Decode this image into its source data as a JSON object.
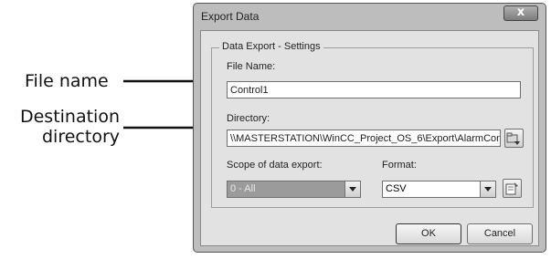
{
  "callouts": {
    "file_name": "File name",
    "destination_line1": "Destination",
    "destination_line2": "directory"
  },
  "window": {
    "title": "Export Data",
    "close_glyph": "x"
  },
  "settings": {
    "group_title": "Data Export - Settings",
    "file_name_label": "File Name:",
    "file_name_value": "Control1",
    "directory_label": "Directory:",
    "directory_value": "\\\\MASTERSTATION\\WinCC_Project_OS_6\\Export\\AlarmCon",
    "browse_icon": "folder-browse-icon",
    "scope_label": "Scope of data export:",
    "scope_value": "0 - All",
    "format_label": "Format:",
    "format_value": "CSV",
    "format_settings_icon": "format-settings-icon"
  },
  "buttons": {
    "ok": "OK",
    "cancel": "Cancel"
  }
}
